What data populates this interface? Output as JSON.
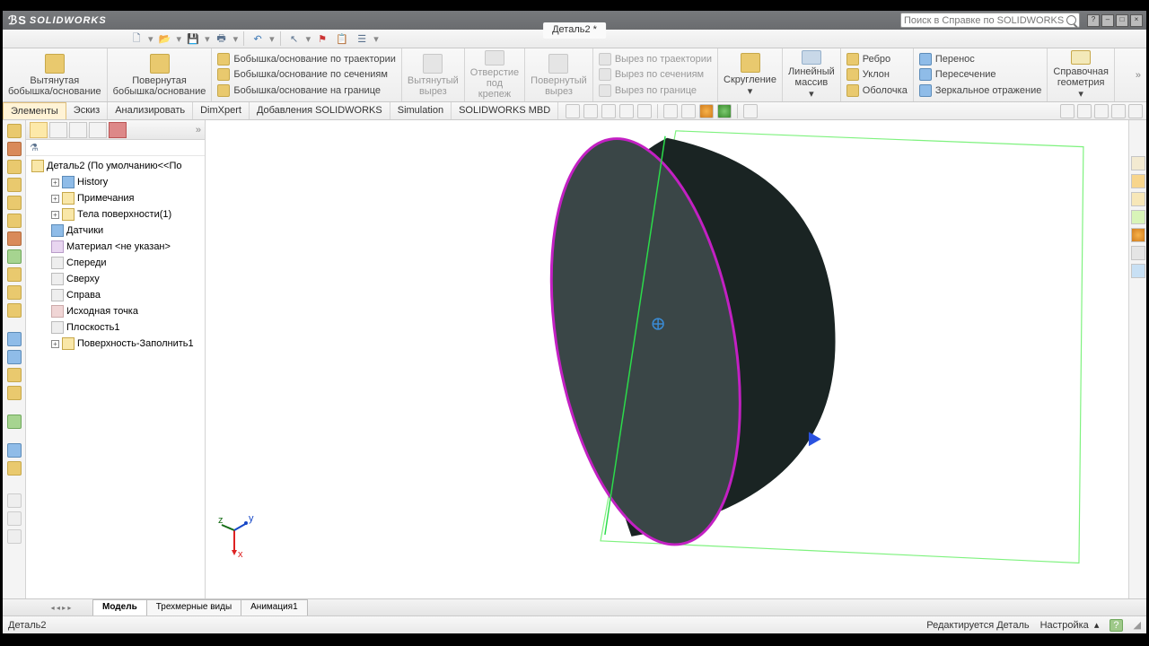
{
  "app": {
    "brand": "SOLIDWORKS",
    "doc_title": "Деталь2 *",
    "search_placeholder": "Поиск в Справке по SOLIDWORKS"
  },
  "ribbon": {
    "g1": {
      "l1": "Вытянутая",
      "l2": "бобышка/основание"
    },
    "g2": {
      "l1": "Повернутая",
      "l2": "бобышка/основание"
    },
    "g3": {
      "r1": "Бобышка/основание по траектории",
      "r2": "Бобышка/основание по сечениям",
      "r3": "Бобышка/основание на границе"
    },
    "g4": {
      "l1": "Вытянутый",
      "l2": "вырез"
    },
    "g5": {
      "l1": "Отверстие",
      "l2": "под",
      "l3": "крепеж"
    },
    "g6": {
      "l1": "Повернутый",
      "l2": "вырез"
    },
    "g7": {
      "r1": "Вырез по траектории",
      "r2": "Вырез по сечениям",
      "r3": "Вырез по границе"
    },
    "g8": "Скругление",
    "g9": {
      "l1": "Линейный",
      "l2": "массив"
    },
    "g10": {
      "r1": "Ребро",
      "r2": "Уклон",
      "r3": "Оболочка"
    },
    "g11": {
      "r1": "Перенос",
      "r2": "Пересечение",
      "r3": "Зеркальное отражение"
    },
    "g12": {
      "l1": "Справочная",
      "l2": "геометрия"
    }
  },
  "cmdtabs": [
    "Элементы",
    "Эскиз",
    "Анализировать",
    "DimXpert",
    "Добавления SOLIDWORKS",
    "Simulation",
    "SOLIDWORKS MBD"
  ],
  "tree": {
    "root": "Деталь2  (По умолчанию<<По",
    "items": [
      "History",
      "Примечания",
      "Тела поверхности(1)",
      "Датчики",
      "Материал <не указан>",
      "Спереди",
      "Сверху",
      "Справа",
      "Исходная точка",
      "Плоскость1",
      "Поверхность-Заполнить1"
    ]
  },
  "lowertabs": [
    "Модель",
    "Трехмерные виды",
    "Анимация1"
  ],
  "status": {
    "left": "Деталь2",
    "mid": "Редактируется Деталь",
    "right": "Настройка"
  },
  "triad": {
    "x": "x",
    "y": "y",
    "z": "z"
  }
}
